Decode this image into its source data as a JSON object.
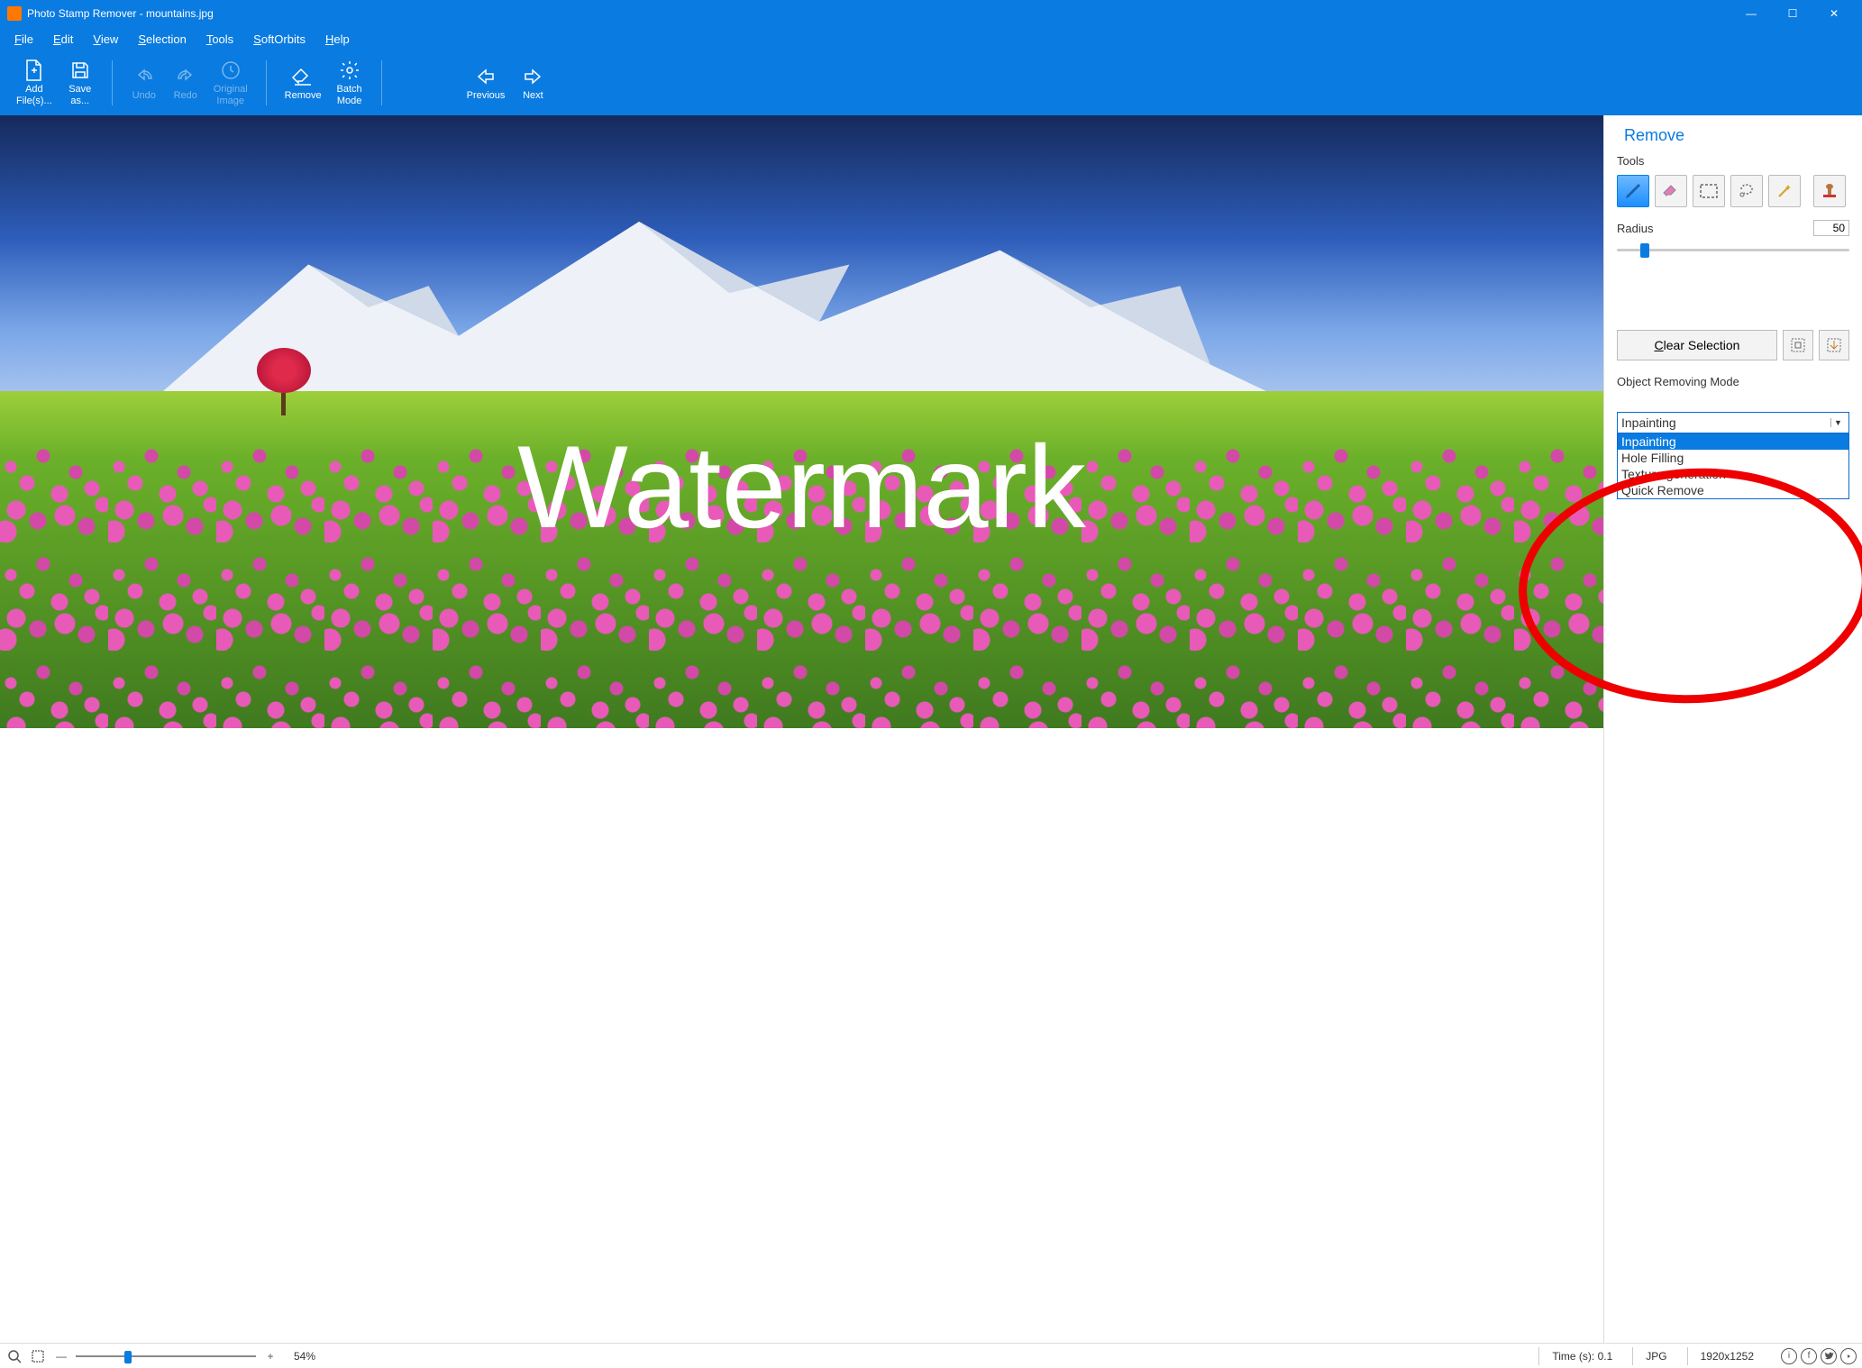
{
  "title": "Photo Stamp Remover - mountains.jpg",
  "window_controls": {
    "min": "—",
    "max": "☐",
    "close": "✕"
  },
  "menu": [
    "File",
    "Edit",
    "View",
    "Selection",
    "Tools",
    "SoftOrbits",
    "Help"
  ],
  "menu_ul": [
    "F",
    "E",
    "V",
    "S",
    "T",
    "S",
    "H"
  ],
  "toolbar": {
    "add": "Add\nFile(s)...",
    "save": "Save\nas...",
    "undo": "Undo",
    "redo": "Redo",
    "original": "Original\nImage",
    "remove": "Remove",
    "batch": "Batch\nMode",
    "previous": "Previous",
    "next": "Next"
  },
  "image": {
    "watermark_text": "Watermark"
  },
  "panel": {
    "title": "Remove",
    "tools_label": "Tools",
    "radius_label": "Radius",
    "radius_value": "50",
    "clear": "Clear Selection",
    "obj_label": "Object Removing Mode",
    "combo_selected": "Inpainting",
    "options": [
      "Inpainting",
      "Hole Filling",
      "Texture generation",
      "Quick Remove"
    ]
  },
  "status": {
    "zoom_pct": "54%",
    "time": "Time (s): 0.1",
    "format": "JPG",
    "dims": "1920x1252"
  }
}
